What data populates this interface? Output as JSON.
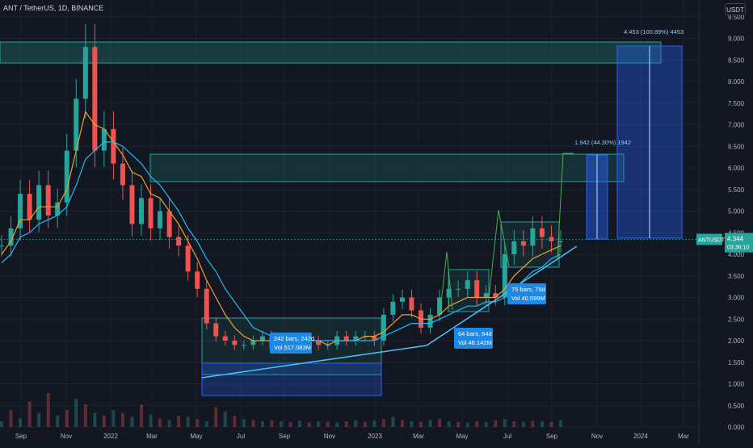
{
  "header": {
    "symbol": "ANT / TetherUS, 1D, BINANCE",
    "currency_button": "USDT"
  },
  "price_tag": {
    "symbol": "ANTUSDT",
    "price": "4.344",
    "countdown": "03:36:10"
  },
  "chart_data": {
    "type": "candlestick",
    "title": "ANT / TetherUS, 1D, BINANCE",
    "x_ticks": [
      "Sep",
      "Nov",
      "2022",
      "Mar",
      "May",
      "Jul",
      "Sep",
      "Nov",
      "2023",
      "Mar",
      "May",
      "Jul",
      "Sep",
      "Nov",
      "2024",
      "Mar"
    ],
    "y_ticks": [
      "9.500",
      "9.000",
      "8.500",
      "8.000",
      "7.500",
      "7.000",
      "6.500",
      "6.000",
      "5.500",
      "5.000",
      "4.500",
      "4.000",
      "3.500",
      "3.000",
      "2.500",
      "2.000",
      "1.500",
      "1.000",
      "0.500",
      "0.000"
    ],
    "ylim": [
      0,
      9.5
    ],
    "last_price": 4.344,
    "series": [
      {
        "name": "price",
        "values": [
          4.2,
          4.6,
          5.4,
          4.8,
          5.6,
          4.9,
          5.2,
          6.4,
          7.6,
          8.8,
          6.4,
          6.9,
          6.1,
          5.6,
          4.7,
          5.3,
          4.6,
          5.0,
          4.4,
          4.2,
          3.6,
          3.2,
          2.4,
          2.1,
          2.0,
          1.9,
          1.9,
          2.0,
          2.1,
          1.8,
          2.0,
          1.9,
          2.0,
          2.0,
          1.9,
          1.9,
          2.1,
          2.0,
          2.1,
          2.1,
          2.0,
          2.6,
          2.9,
          3.0,
          2.7,
          2.3,
          2.6,
          3.0,
          3.2,
          3.2,
          3.4,
          3.0,
          3.1,
          3.0,
          4.0,
          4.3,
          4.2,
          4.6,
          4.4,
          4.3,
          4.3
        ]
      },
      {
        "values": [
          4.0,
          4.3,
          4.8,
          4.8,
          5.1,
          5.1,
          5.1,
          5.5,
          6.4,
          7.3,
          7.0,
          6.9,
          6.6,
          6.3,
          5.9,
          5.8,
          5.4,
          5.3,
          5.0,
          4.7,
          4.3,
          3.9,
          3.4,
          3.0,
          2.6,
          2.3,
          2.1,
          2.0,
          2.0,
          2.0,
          2.0,
          2.0,
          2.0,
          2.0,
          2.0,
          1.9,
          2.0,
          2.0,
          2.0,
          2.1,
          2.1,
          2.2,
          2.4,
          2.6,
          2.6,
          2.5,
          2.5,
          2.6,
          2.8,
          2.9,
          3.0,
          3.0,
          3.0,
          3.0,
          3.2,
          3.5,
          3.7,
          3.9,
          4.0,
          4.1,
          4.2
        ]
      },
      {
        "values": [
          3.8,
          4.0,
          4.4,
          4.5,
          4.7,
          4.8,
          4.9,
          5.1,
          5.6,
          6.2,
          6.4,
          6.6,
          6.6,
          6.5,
          6.3,
          6.1,
          5.8,
          5.6,
          5.3,
          5.0,
          4.6,
          4.3,
          3.9,
          3.6,
          3.2,
          2.9,
          2.6,
          2.3,
          2.2,
          2.1,
          2.0,
          2.0,
          2.0,
          2.0,
          2.0,
          2.0,
          2.0,
          2.0,
          2.0,
          2.0,
          2.0,
          2.1,
          2.2,
          2.3,
          2.4,
          2.4,
          2.4,
          2.5,
          2.6,
          2.7,
          2.8,
          2.8,
          2.9,
          2.9,
          3.0,
          3.2,
          3.4,
          3.6,
          3.7,
          3.9,
          4.0
        ]
      }
    ],
    "annotations": {
      "measure_1": {
        "label": "242 bars, 242d",
        "vol": "Vol 517.083M"
      },
      "measure_2": {
        "label": "64 bars, 64d",
        "vol": "Vol 46.142M"
      },
      "measure_3": {
        "label": "75 bars, 75d",
        "vol": "Vol 40.599M"
      },
      "target_1": "1.942 (44.30%) 1942",
      "target_2": "4.453 (100.89%) 4453"
    }
  }
}
